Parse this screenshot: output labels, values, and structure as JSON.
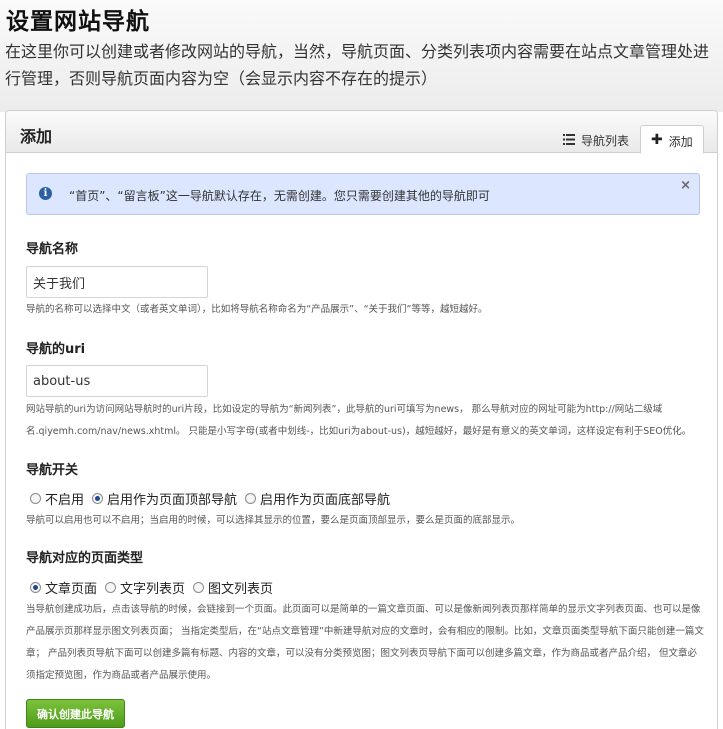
{
  "page": {
    "title": "设置网站导航",
    "description": "在这里你可以创建或者修改网站的导航，当然，导航页面、分类列表项内容需要在站点文章管理处进行管理，否则导航页面内容为空（会显示内容不存在的提示）"
  },
  "panel": {
    "title": "添加",
    "tabs": [
      {
        "label": "导航列表",
        "icon": "list-icon",
        "active": false
      },
      {
        "label": "添加",
        "icon": "plus-icon",
        "active": true
      }
    ]
  },
  "alert": {
    "icon": "info-icon",
    "text": "“首页”、“留言板”这一导航默认存在，无需创建。您只需要创建其他的导航即可",
    "close": "×",
    "bg_color": "#dce6ff"
  },
  "form": {
    "name": {
      "label": "导航名称",
      "value": "关于我们",
      "help": "导航的名称可以选择中文（或者英文单词），比如将导航名称命名为“产品展示”、“关于我们”等等，越短越好。"
    },
    "uri": {
      "label": "导航的uri",
      "value": "about-us",
      "help": "网站导航的uri为访问网站导航时的uri片段，比如设定的导航为“新闻列表”，此导航的uri可填写为news， 那么导航对应的网址可能为http://网站二级域名.qiyemh.com/nav/news.xhtml。 只能是小写字母(或者中划线-，比如uri为about-us)，越短越好，最好是有意义的英文单词，这样设定有利于SEO优化。"
    },
    "toggle": {
      "label": "导航开关",
      "options": [
        "不启用",
        "启用作为页面顶部导航",
        "启用作为页面底部导航"
      ],
      "selected": 1,
      "help": "导航可以启用也可以不启用；当启用的时候，可以选择其显示的位置，要么是页面顶部显示，要么是页面的底部显示。"
    },
    "page_type": {
      "label": "导航对应的页面类型",
      "options": [
        "文章页面",
        "文字列表页",
        "图文列表页"
      ],
      "selected": 0,
      "help": "当导航创建成功后，点击该导航的时候，会链接到一个页面。此页面可以是简单的一篇文章页面、可以是像新闻列表页那样简单的显示文字列表页面、也可以是像产品展示页那样显示图文列表页面； 当指定类型后，在“站点文章管理”中新建导航对应的文章时，会有相应的限制。比如，文章页面类型导航下面只能创建一篇文章； 产品列表页导航下面可以创建多篇有标题、内容的文章，可以没有分类预览图；图文列表页导航下面可以创建多篇文章，作为商品或者产品介绍， 但文章必须指定预览图，作为商品或者产品展示使用。"
    },
    "submit_label": "确认创建此导航",
    "submit_color": "#5aa823"
  }
}
